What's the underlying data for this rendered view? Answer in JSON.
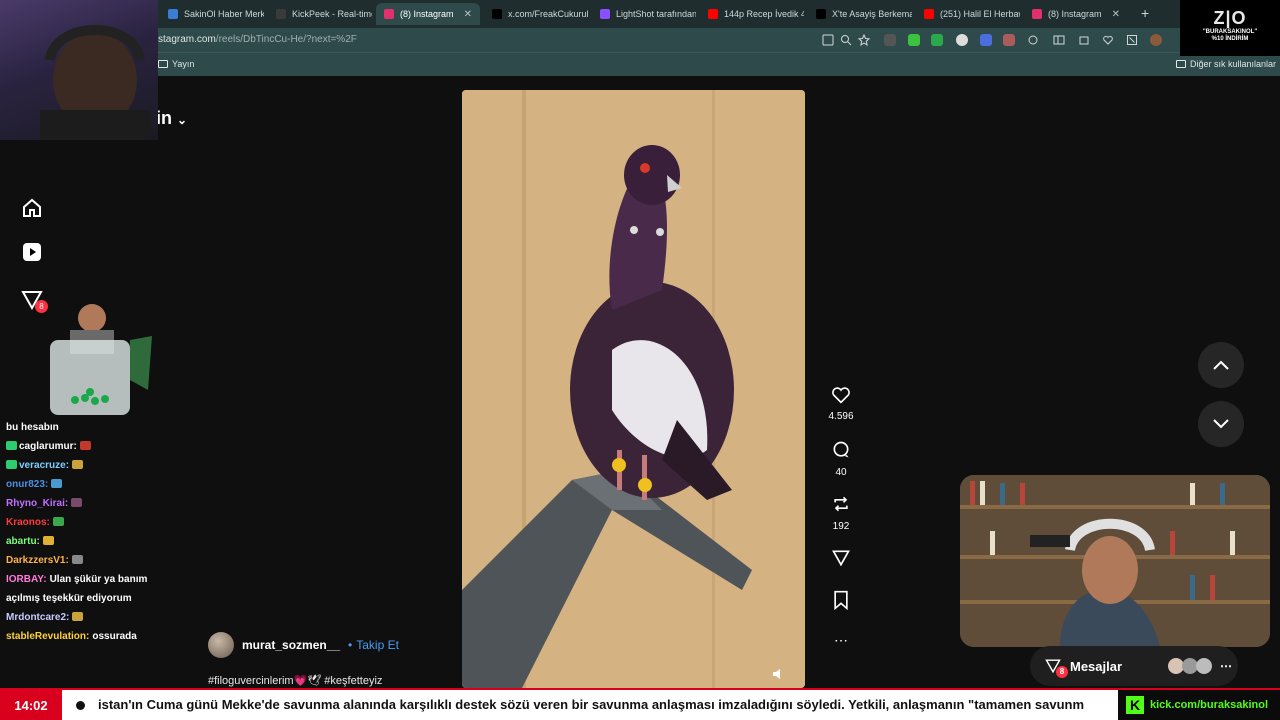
{
  "tabs": [
    {
      "label": "SakinOl Haber Merk",
      "color": "#3a7bd5"
    },
    {
      "label": "KickPeek - Real-time",
      "color": "#3a3a3a"
    },
    {
      "label": "(8) Instagram",
      "color": "#e1306c",
      "active": true
    },
    {
      "label": "x.com/FreakCukurul",
      "color": "#000000"
    },
    {
      "label": "LightShot tarafından",
      "color": "#8a4fff"
    },
    {
      "label": "144p Recep İvedik 4",
      "color": "#ff0000"
    },
    {
      "label": "X'te Asayiş Berkemal",
      "color": "#000000"
    },
    {
      "label": "(251) Halil El Herbaw",
      "color": "#ff0000"
    },
    {
      "label": "(8) Instagram",
      "color": "#e1306c"
    }
  ],
  "address": {
    "prefix": "stagram.com",
    "path": "/reels/DbTincCu-He/?next=%2F"
  },
  "bookmarks": {
    "left": "Yayın",
    "right": "Diğer sık kullanılanlar"
  },
  "brand": {
    "partial": "in"
  },
  "nav": {
    "notification_count": "8"
  },
  "reel": {
    "likes": "4.596",
    "comments": "40",
    "reposts": "192",
    "author": "murat_sozmen__",
    "separator": "•",
    "follow": "Takip Et",
    "caption": "#filoguvercinlerim💗🕊 #keşfetteyiz"
  },
  "chat": [
    {
      "user": "",
      "text": "bu hesabın",
      "color": "#ffffff"
    },
    {
      "user": "caglarumur:",
      "text": "",
      "color": "#ffffff",
      "badge": true
    },
    {
      "user": "veracruze:",
      "text": "",
      "color": "#7fd0ff",
      "badge": true
    },
    {
      "user": "onur823:",
      "text": "",
      "color": "#4a90e2"
    },
    {
      "user": "Rhyno_Kirai:",
      "text": "",
      "color": "#c070ff"
    },
    {
      "user": "Kraonos:",
      "text": "",
      "color": "#ff3b3b"
    },
    {
      "user": "abartu:",
      "text": "",
      "color": "#7cff7c"
    },
    {
      "user": "DarkzzersV1:",
      "text": "",
      "color": "#ffb34a"
    },
    {
      "user": "IORBAY:",
      "text": "Ulan şükür ya banım",
      "color": "#ff7ad9"
    },
    {
      "user": "",
      "text": "açılmış teşekkür ediyorum",
      "color": "#ffffff"
    },
    {
      "user": "Mrdontcare2:",
      "text": "",
      "color": "#c9c9ff"
    },
    {
      "user": "stableRevulation:",
      "text": "ossurada",
      "color": "#ffd23a"
    }
  ],
  "overlay": {
    "logo": "Z|O",
    "logo_code": "\"BURAKSAKINOL\"",
    "logo_discount": "%10 İNDİRİM",
    "messages_label": "Mesajlar",
    "messages_count": "8"
  },
  "ticker": {
    "time": "14:02",
    "text": "istan'ın Cuma günü Mekke'de savunma alanında karşılıklı destek sözü veren bir savunma anlaşması imzaladığını söyledi. Yetkili, anlaşmanın \"tamamen savunm",
    "kick": "kick.com/buraksakinol"
  }
}
